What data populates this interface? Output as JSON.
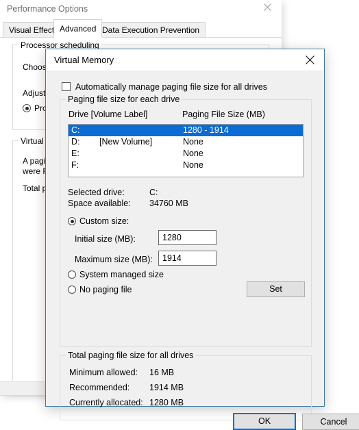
{
  "background_window": {
    "title": "Performance Options",
    "close_icon": "close-icon",
    "tabs": [
      {
        "label": "Visual Effects",
        "selected": false
      },
      {
        "label": "Advanced",
        "selected": true
      },
      {
        "label": "Data Execution Prevention",
        "selected": false
      }
    ],
    "processor_group": {
      "title": "Processor scheduling",
      "line1": "Choose",
      "line2": "Adjust f",
      "radio_label": "Prog",
      "radio_checked": true
    },
    "virtual_memory_group": {
      "title": "Virtual m",
      "line1": "A pagin",
      "line2": "were RA",
      "line3": "Total pa"
    }
  },
  "dialog": {
    "title": "Virtual Memory",
    "close_icon": "close-icon",
    "auto_manage": {
      "label": "Automatically manage paging file size for all drives",
      "checked": false
    },
    "paging_group": {
      "title": "Paging file size for each drive",
      "columns": {
        "drive": "Drive  [Volume Label]",
        "size": "Paging File Size (MB)"
      },
      "rows": [
        {
          "drive": "C:",
          "volume_label": "",
          "size": "1280 - 1914",
          "selected": true
        },
        {
          "drive": "D:",
          "volume_label": "[New Volume]",
          "size": "None",
          "selected": false
        },
        {
          "drive": "E:",
          "volume_label": "",
          "size": "None",
          "selected": false
        },
        {
          "drive": "F:",
          "volume_label": "",
          "size": "None",
          "selected": false
        }
      ],
      "selected_drive_label": "Selected drive:",
      "selected_drive_value": "C:",
      "space_available_label": "Space available:",
      "space_available_value": "34760 MB",
      "custom_size_label": "Custom size:",
      "custom_size_selected": true,
      "initial_size_label": "Initial size (MB):",
      "initial_size_value": "1280",
      "maximum_size_label": "Maximum size (MB):",
      "maximum_size_value": "1914",
      "system_managed_label": "System managed size",
      "system_managed_selected": false,
      "no_paging_label": "No paging file",
      "no_paging_selected": false,
      "set_button": "Set"
    },
    "total_group": {
      "title": "Total paging file size for all drives",
      "rows": [
        {
          "label": "Minimum allowed:",
          "value": "16 MB"
        },
        {
          "label": "Recommended:",
          "value": "1914 MB"
        },
        {
          "label": "Currently allocated:",
          "value": "1280 MB"
        }
      ]
    },
    "footer": {
      "ok": "OK",
      "cancel": "Cancel"
    }
  },
  "colors": {
    "accent_blue": "#0a6cd4",
    "dialog_border": "#3e7ca6",
    "dialog_face": "#f0f0f0",
    "button_face": "#e1e1e1",
    "selection_text": "#ffffff"
  }
}
